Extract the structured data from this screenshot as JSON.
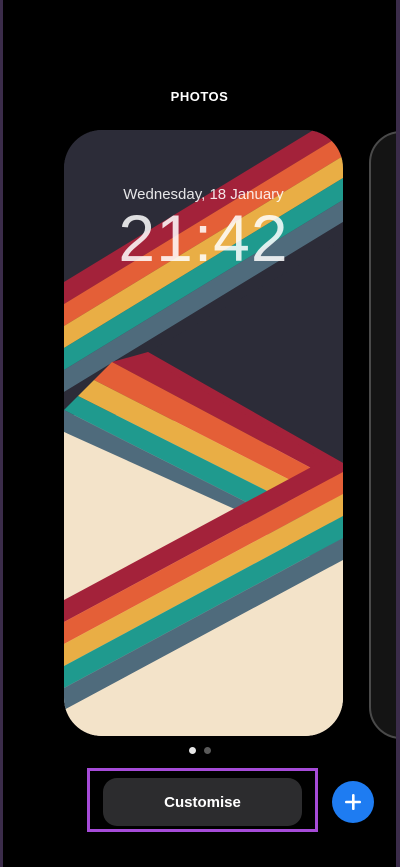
{
  "header": {
    "label": "PHOTOS"
  },
  "lock_screen": {
    "date": "Wednesday, 18 January",
    "time": "21:42"
  },
  "page_indicator": {
    "total": 2,
    "active": 1
  },
  "actions": {
    "customise_label": "Customise",
    "add_icon": "plus-icon"
  },
  "colors": {
    "wallpaper_dark": "#2c2c38",
    "wallpaper_light": "#f3e3c9",
    "stripe_red": "#a3223a",
    "stripe_orange": "#e45f37",
    "stripe_yellow": "#e9ae45",
    "stripe_teal": "#1f9a8e",
    "stripe_slate": "#4f6b7c",
    "highlight": "#a64bd8",
    "add_button": "#1e7cf2"
  }
}
